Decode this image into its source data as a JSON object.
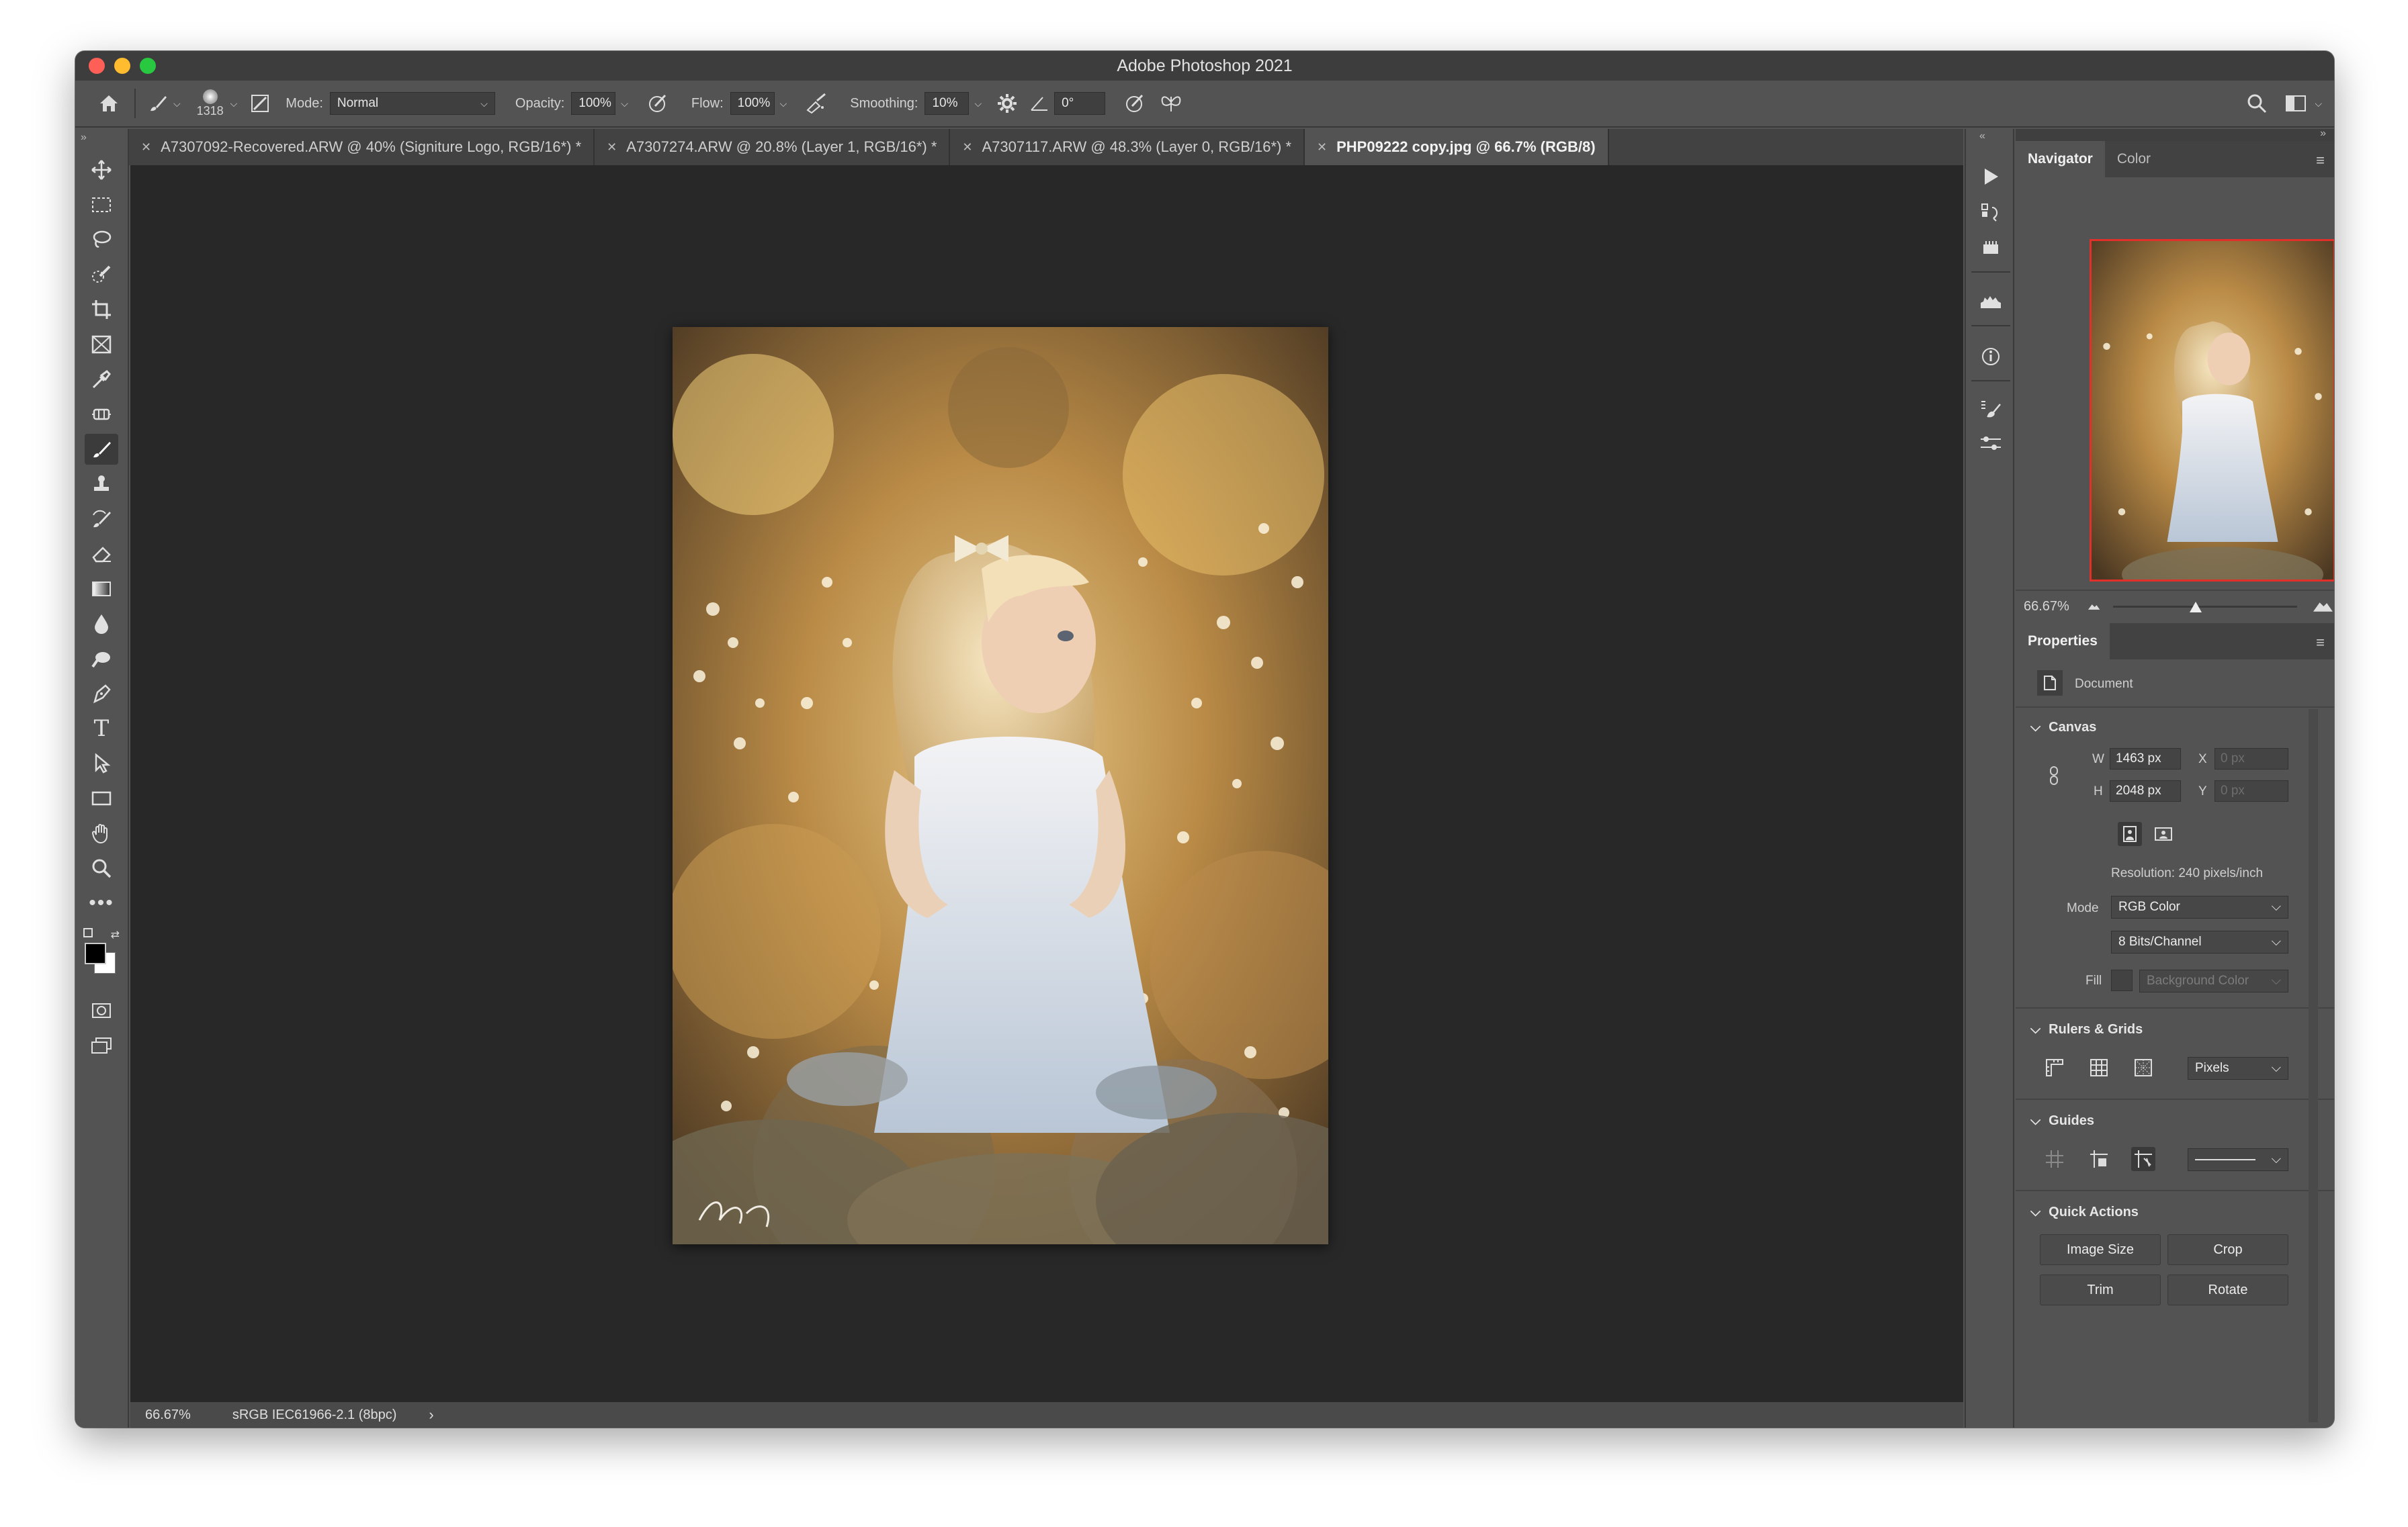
{
  "app": {
    "title": "Adobe Photoshop 2021"
  },
  "options_bar": {
    "brush_size": "1318",
    "mode_label": "Mode:",
    "mode_value": "Normal",
    "opacity_label": "Opacity:",
    "opacity_value": "100%",
    "flow_label": "Flow:",
    "flow_value": "100%",
    "smoothing_label": "Smoothing:",
    "smoothing_value": "10%",
    "angle_value": "0°"
  },
  "tabs": [
    {
      "label": "A7307092-Recovered.ARW @ 40% (Signiture Logo, RGB/16*) *",
      "active": false
    },
    {
      "label": "A7307274.ARW @ 20.8% (Layer 1, RGB/16*) *",
      "active": false
    },
    {
      "label": "A7307117.ARW @ 48.3% (Layer 0, RGB/16*) *",
      "active": false
    },
    {
      "label": "PHP09222 copy.jpg @ 66.7% (RGB/8)",
      "active": true
    }
  ],
  "status": {
    "zoom": "66.67%",
    "profile": "sRGB IEC61966-2.1 (8bpc)"
  },
  "navigator": {
    "tab_navigator": "Navigator",
    "tab_color": "Color",
    "zoom": "66.67%",
    "zoom_level": 0.45
  },
  "properties": {
    "tab": "Properties",
    "document_label": "Document",
    "canvas": {
      "heading": "Canvas",
      "w_label": "W",
      "w_value": "1463 px",
      "h_label": "H",
      "h_value": "2048 px",
      "x_label": "X",
      "x_value": "0 px",
      "y_label": "Y",
      "y_value": "0 px",
      "resolution": "Resolution: 240 pixels/inch",
      "mode_label": "Mode",
      "mode_value": "RGB Color",
      "depth_value": "8 Bits/Channel",
      "fill_label": "Fill",
      "fill_value": "Background Color"
    },
    "rulers": {
      "heading": "Rulers & Grids",
      "unit": "Pixels"
    },
    "guides": {
      "heading": "Guides"
    },
    "quick_actions": {
      "heading": "Quick Actions",
      "image_size": "Image Size",
      "crop": "Crop",
      "trim": "Trim",
      "rotate": "Rotate"
    }
  },
  "colors": {
    "window": "#535353",
    "canvas": "#282828",
    "nav_frame": "#e1302a"
  }
}
